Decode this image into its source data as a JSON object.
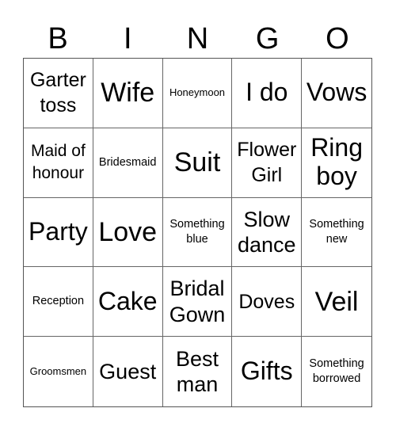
{
  "header": {
    "letters": [
      "B",
      "I",
      "N",
      "G",
      "O"
    ]
  },
  "cells": [
    {
      "text": "Garter toss",
      "size": "m"
    },
    {
      "text": "Wife",
      "size": "xl"
    },
    {
      "text": "Honeymoon",
      "size": "xs"
    },
    {
      "text": "I do",
      "size": "l"
    },
    {
      "text": "Vows",
      "size": "l"
    },
    {
      "text": "Maid of honour",
      "size": "sm"
    },
    {
      "text": "Bridesmaid",
      "size": "s"
    },
    {
      "text": "Suit",
      "size": "xl"
    },
    {
      "text": "Flower Girl",
      "size": "m"
    },
    {
      "text": "Ring boy",
      "size": "l"
    },
    {
      "text": "Party",
      "size": "l"
    },
    {
      "text": "Love",
      "size": "xl"
    },
    {
      "text": "Something blue",
      "size": "s"
    },
    {
      "text": "Slow dance",
      "size": "ml"
    },
    {
      "text": "Something new",
      "size": "s"
    },
    {
      "text": "Reception",
      "size": "s"
    },
    {
      "text": "Cake",
      "size": "l"
    },
    {
      "text": "Bridal Gown",
      "size": "ml"
    },
    {
      "text": "Doves",
      "size": "m"
    },
    {
      "text": "Veil",
      "size": "xl"
    },
    {
      "text": "Groomsmen",
      "size": "xs"
    },
    {
      "text": "Guest",
      "size": "ml"
    },
    {
      "text": "Best man",
      "size": "ml"
    },
    {
      "text": "Gifts",
      "size": "l"
    },
    {
      "text": "Something borrowed",
      "size": "s"
    }
  ]
}
